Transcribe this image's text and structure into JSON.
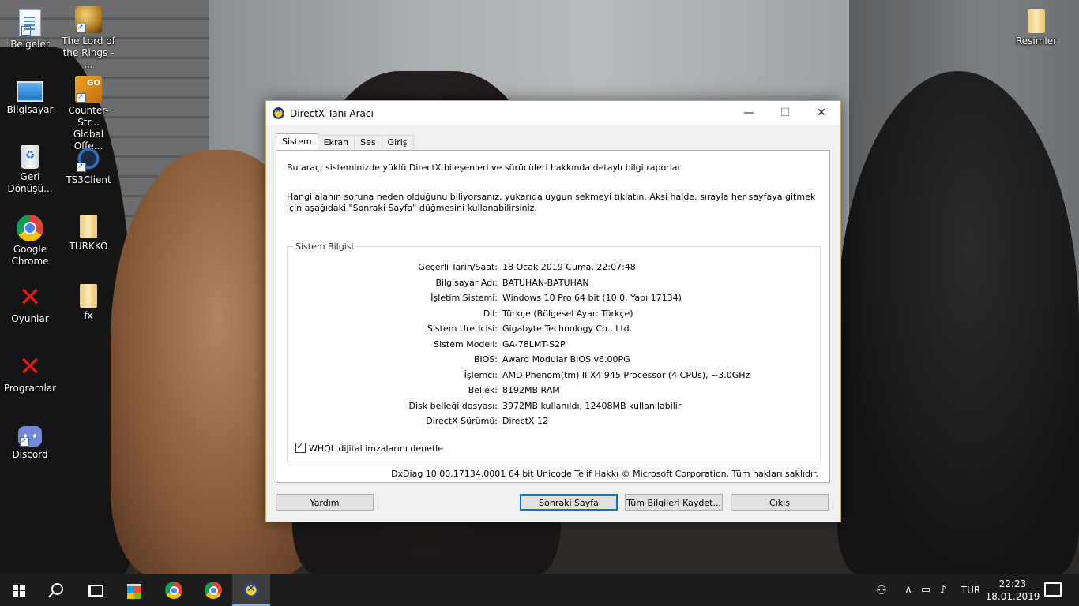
{
  "desktop": {
    "icons_col1": [
      {
        "label": "Belgeler",
        "icon": "document-icon"
      },
      {
        "label": "Bilgisayar",
        "icon": "computer-icon"
      },
      {
        "label": "Geri\nDönüşü...",
        "icon": "recycle-bin-icon"
      },
      {
        "label": "Google\nChrome",
        "icon": "chrome-icon"
      },
      {
        "label": "Oyunlar",
        "icon": "red-x-icon"
      },
      {
        "label": "Programlar",
        "icon": "red-x-icon"
      },
      {
        "label": "Discord",
        "icon": "discord-icon"
      }
    ],
    "icons_col2": [
      {
        "label": "The Lord of\nthe Rings - ...",
        "icon": "lotr-icon"
      },
      {
        "label": "Counter-Str...\nGlobal Offe...",
        "icon": "csgo-icon"
      },
      {
        "label": "TS3Client",
        "icon": "teamspeak-icon"
      },
      {
        "label": "TURKKO",
        "icon": "folder-icon"
      },
      {
        "label": "fx",
        "icon": "folder-icon"
      }
    ],
    "icon_right": {
      "label": "Resimler",
      "icon": "folder-icon"
    }
  },
  "window": {
    "title": "DirectX Tanı Aracı",
    "minimize": "—",
    "maximize": "☐",
    "close": "✕",
    "tabs": [
      "Sistem",
      "Ekran",
      "Ses",
      "Giriş"
    ],
    "active_tab": "Sistem",
    "intro_1": "Bu araç, sisteminizde yüklü DirectX bileşenleri ve sürücüleri hakkında detaylı bilgi raporlar.",
    "intro_2": "Hangi alanın soruna neden olduğunu biliyorsanız, yukarıda uygun sekmeyi tıklatın. Aksi halde, sırayla her sayfaya gitmek için aşağıdaki \"Sonraki Sayfa\" düğmesini kullanabilirsiniz.",
    "group_title": "Sistem Bilgisi",
    "rows": [
      {
        "label": "Geçerli Tarih/Saat:",
        "value": "18 Ocak 2019 Cuma, 22:07:48"
      },
      {
        "label": "Bilgisayar Adı:",
        "value": "BATUHAN-BATUHAN"
      },
      {
        "label": "İşletim Sistemi:",
        "value": "Windows 10 Pro 64 bit (10.0, Yapı 17134)"
      },
      {
        "label": "Dil:",
        "value": "Türkçe (Bölgesel Ayar: Türkçe)"
      },
      {
        "label": "Sistem Üreticisi:",
        "value": "Gigabyte Technology Co., Ltd."
      },
      {
        "label": "Sistem Modeli:",
        "value": "GA-78LMT-S2P"
      },
      {
        "label": "BIOS:",
        "value": "Award Modular BIOS v6.00PG"
      },
      {
        "label": "İşlemci:",
        "value": "AMD Phenom(tm) II X4 945 Processor (4 CPUs), ~3.0GHz"
      },
      {
        "label": "Bellek:",
        "value": "8192MB RAM"
      },
      {
        "label": "Disk belleği dosyası:",
        "value": "3972MB kullanıldı, 12408MB kullanılabilir"
      },
      {
        "label": "DirectX Sürümü:",
        "value": "DirectX 12"
      }
    ],
    "checkbox_label": "WHQL dijital imzalarını denetle",
    "footer": "DxDiag 10.00.17134.0001 64 bit Unicode  Telif Hakkı © Microsoft Corporation. Tüm hakları saklıdır.",
    "buttons": {
      "help": "Yardım",
      "next": "Sonraki Sayfa",
      "save": "Tüm Bilgileri Kaydet...",
      "exit": "Çıkış"
    }
  },
  "taskbar": {
    "language": "TUR",
    "time": "22:23",
    "date": "18.01.2019"
  },
  "colors": {
    "taskbar": "#1c1c1c",
    "accent": "#0078d7",
    "window_border": "#c9a75a"
  }
}
